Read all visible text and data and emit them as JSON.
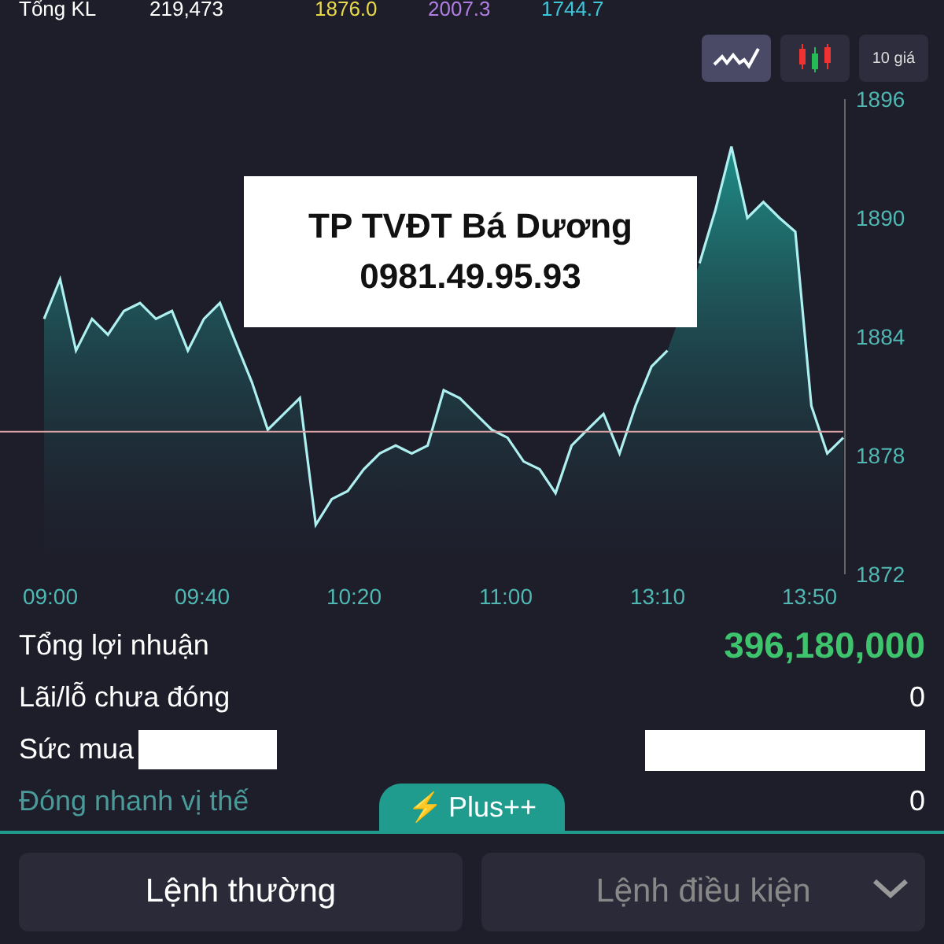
{
  "stats_row": {
    "label": "Tổng KL",
    "volume": "219,473",
    "prices": [
      {
        "value": "1876.0",
        "color": "#e8d84a"
      },
      {
        "value": "2007.3",
        "color": "#b07ee0"
      },
      {
        "value": "1744.7",
        "color": "#3fc6d8"
      }
    ]
  },
  "chart_modes": [
    {
      "kind": "line",
      "selected": true
    },
    {
      "kind": "candle",
      "selected": false
    },
    {
      "kind": "text",
      "label": "10 giá",
      "selected": false
    }
  ],
  "chart": {
    "time_labels": [
      "09:00",
      "09:40",
      "10:20",
      "11:00",
      "13:10",
      "13:50"
    ],
    "chart_data": {
      "type": "area",
      "ylim": [
        1872,
        1896
      ],
      "yticks": [
        1872,
        1878,
        1884,
        1890,
        1896
      ],
      "ref_lines": [
        {
          "axis": "y",
          "value": 1879.2
        }
      ],
      "values": [
        1884.9,
        1886.9,
        1883.3,
        1884.9,
        1884.1,
        1885.3,
        1885.7,
        1884.9,
        1885.3,
        1883.3,
        1884.9,
        1885.7,
        1883.7,
        1881.7,
        1879.3,
        1880.1,
        1880.9,
        1874.5,
        1875.8,
        1876.2,
        1877.3,
        1878.1,
        1878.5,
        1878.1,
        1878.5,
        1881.3,
        1880.9,
        1880.1,
        1879.3,
        1878.9,
        1877.7,
        1877.3,
        1876.1,
        1878.5,
        1879.3,
        1880.1,
        1878.1,
        1880.5,
        1882.5,
        1883.3,
        null,
        1887.7,
        1890.4,
        1893.6,
        1890.0,
        1890.8,
        1890.0,
        1889.3,
        1880.5,
        1878.1,
        1878.9
      ]
    }
  },
  "overlay_note": [
    "TP TVĐT Bá Dương",
    "0981.49.95.93"
  ],
  "summary": [
    {
      "kind": "profit",
      "label": "Tổng lợi nhuận",
      "value": "396,180,000"
    },
    {
      "kind": "plain",
      "label": "Lãi/lỗ chưa đóng",
      "value": "0"
    },
    {
      "kind": "redacted",
      "label": "Sức mua"
    },
    {
      "kind": "muted",
      "label": "Đóng nhanh vị thế",
      "value": "0"
    }
  ],
  "plus_tab": {
    "icon": "⚡",
    "label": "Plus++"
  },
  "order_tabs": [
    {
      "label": "Lệnh thường",
      "selected": true
    },
    {
      "label": "Lệnh điều kiện",
      "selected": false,
      "dropdown": true
    }
  ]
}
